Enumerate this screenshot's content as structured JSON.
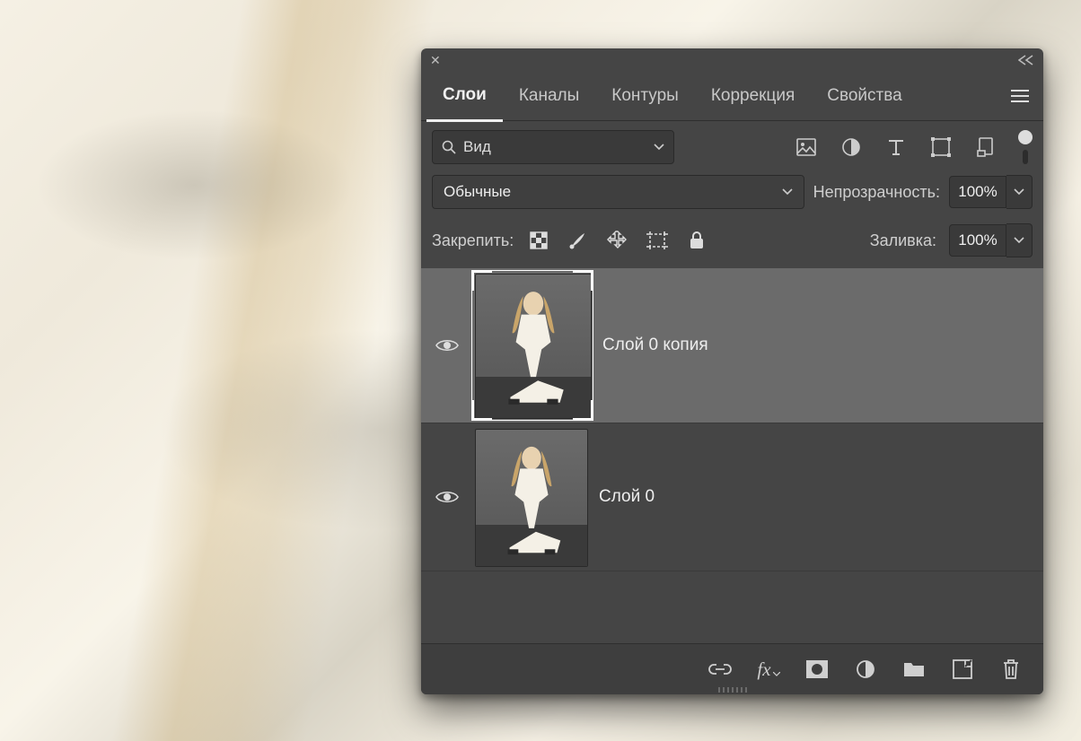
{
  "tabs": [
    "Слои",
    "Каналы",
    "Контуры",
    "Коррекция",
    "Свойства"
  ],
  "active_tab_index": 0,
  "filter": {
    "label": "Вид"
  },
  "blend_mode": "Обычные",
  "opacity": {
    "label": "Непрозрачность:",
    "value": "100%"
  },
  "fill": {
    "label": "Заливка:",
    "value": "100%"
  },
  "lock_label": "Закрепить:",
  "layers": [
    {
      "name": "Слой 0 копия",
      "selected": true,
      "visible": true
    },
    {
      "name": "Слой 0",
      "selected": false,
      "visible": true
    }
  ],
  "icons": {
    "image": "image-filter-icon",
    "circle": "adjustment-filter-icon",
    "text": "type-filter-icon",
    "shape": "shape-filter-icon",
    "smart": "smart-filter-icon",
    "lock_pixels": "lock-pixels-icon",
    "lock_brush": "lock-brush-icon",
    "lock_move": "lock-move-icon",
    "lock_artboard": "lock-artboard-icon",
    "lock_all": "lock-all-icon",
    "link": "link-icon",
    "fx": "fx-icon",
    "mask": "mask-icon",
    "adj": "adjustment-icon",
    "group": "group-icon",
    "new": "new-layer-icon",
    "trash": "trash-icon"
  }
}
